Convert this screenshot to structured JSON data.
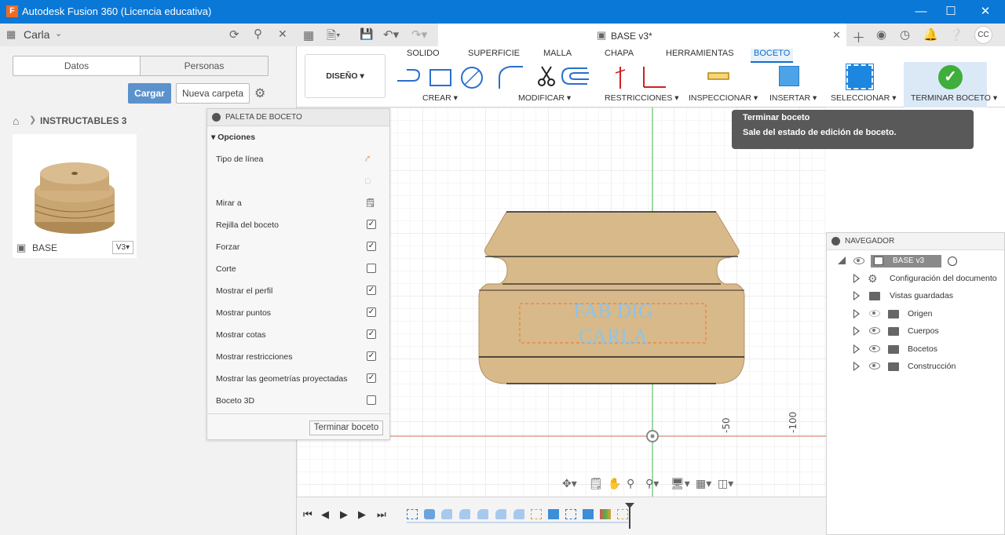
{
  "window": {
    "title": "Autodesk Fusion 360 (Licencia educativa)",
    "app_icon": "F"
  },
  "left_panel": {
    "user": "Carla",
    "tabs": [
      "Datos",
      "Personas"
    ],
    "upload_label": "Cargar",
    "new_folder_label": "Nueva carpeta",
    "breadcrumb": "INSTRUCTABLES 3",
    "item": {
      "name": "BASE",
      "version": "V3"
    }
  },
  "document_tab": {
    "name": "BASE v3*"
  },
  "ribbon": {
    "workspace": "DISEÑO",
    "tabs": [
      "SOLIDO",
      "SUPERFICIE",
      "MALLA",
      "CHAPA",
      "HERRAMIENTAS",
      "BOCETO"
    ],
    "active_tab": "BOCETO",
    "groups": [
      "CREAR",
      "MODIFICAR",
      "RESTRICCIONES",
      "INSPECCIONAR",
      "INSERTAR",
      "SELECCIONAR",
      "TERMINAR BOCETO"
    ]
  },
  "sketch_palette": {
    "title": "PALETA DE BOCETO",
    "section": "Opciones",
    "rows": [
      {
        "label": "Tipo de línea",
        "kind": "icon"
      },
      {
        "label": "",
        "kind": "icon"
      },
      {
        "label": "Mirar a",
        "kind": "icon"
      },
      {
        "label": "Rejilla del boceto",
        "checked": true
      },
      {
        "label": "Forzar",
        "checked": true
      },
      {
        "label": "Corte",
        "checked": false
      },
      {
        "label": "Mostrar el perfil",
        "checked": true
      },
      {
        "label": "Mostrar puntos",
        "checked": true
      },
      {
        "label": "Mostrar cotas",
        "checked": true
      },
      {
        "label": "Mostrar restricciones",
        "checked": true
      },
      {
        "label": "Mostrar las geometrías proyectadas",
        "checked": true
      },
      {
        "label": "Boceto 3D",
        "checked": false
      }
    ],
    "finish_label": "Terminar boceto"
  },
  "tooltip": {
    "title": "Terminar boceto",
    "text": "Sale del estado de edición de boceto."
  },
  "canvas": {
    "text_line1": "FAB DIG",
    "text_line2": "CARLA",
    "axis_label_1": "-50",
    "axis_label_2": "-100"
  },
  "navigator": {
    "title": "NAVEGADOR",
    "root": "BASE v3",
    "items": [
      "Configuración del documento",
      "Vistas guardadas",
      "Origen",
      "Cuerpos",
      "Bocetos",
      "Construcción"
    ]
  },
  "colors": {
    "titlebar": "#0a78d7",
    "accent": "#5b92cc",
    "model": "#d8b98a",
    "finish_green": "#3fae3c"
  }
}
